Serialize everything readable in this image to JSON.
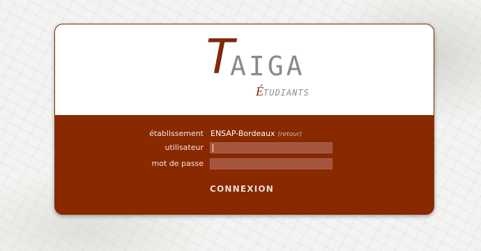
{
  "logo": {
    "initial": "T",
    "rest": "AIGA",
    "sub_initial": "É",
    "sub_rest": "TUDIANTS"
  },
  "form": {
    "etablissement_label": "établissement",
    "etablissement_value": "ENSAP-Bordeaux",
    "retour_link": "(retour)",
    "utilisateur_label": "utilisateur",
    "utilisateur_value": "",
    "password_label": "mot de passe",
    "password_value": "",
    "submit_label": "CONNEXION"
  },
  "colors": {
    "brand": "#882900",
    "input_bg": "#a5553d",
    "logo_gray": "#8a8a8a"
  }
}
